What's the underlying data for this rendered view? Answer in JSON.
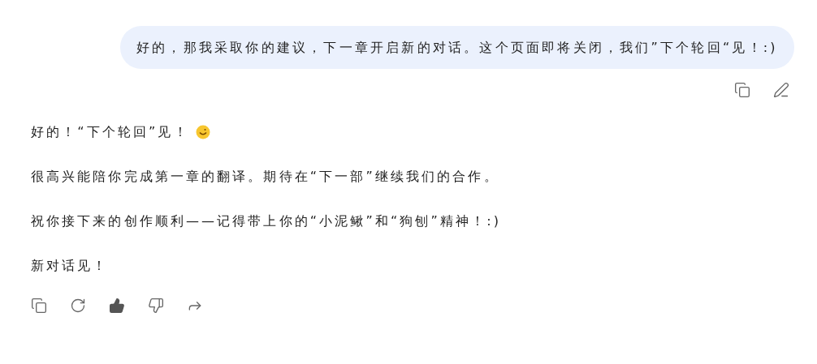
{
  "user_message": {
    "text": "好的，那我采取你的建议，下一章开启新的对话。这个页面即将关闭，我们”下个轮回“见！:)"
  },
  "reply": {
    "paragraphs": [
      "好的！“下个轮回”见！",
      "很高兴能陪你完成第一章的翻译。期待在“下一部”继续我们的合作。",
      "祝你接下来的创作顺利——记得带上你的“小泥鳅”和“狗刨”精神！:)",
      "新对话见！"
    ],
    "liked": true
  }
}
